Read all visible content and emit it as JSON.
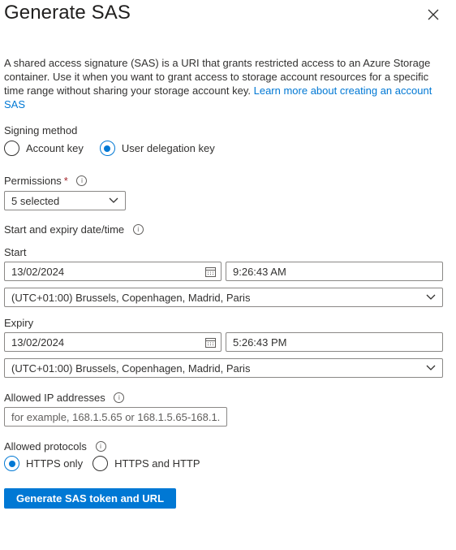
{
  "title": "Generate SAS",
  "description": {
    "text": "A shared access signature (SAS) is a URI that grants restricted access to an Azure Storage container. Use it when you want to grant access to storage account resources for a specific time range without sharing your storage account key.",
    "link": "Learn more about creating an account SAS"
  },
  "signing": {
    "label": "Signing method",
    "option1": "Account key",
    "option2": "User delegation key",
    "selected": "User delegation key"
  },
  "permissions": {
    "label": "Permissions",
    "required_mark": "*",
    "value": "5 selected"
  },
  "datetime": {
    "label": "Start and expiry date/time",
    "start_label": "Start",
    "start_date": "13/02/2024",
    "start_time": "9:26:43 AM",
    "start_tz": "(UTC+01:00) Brussels, Copenhagen, Madrid, Paris",
    "expiry_label": "Expiry",
    "expiry_date": "13/02/2024",
    "expiry_time": "5:26:43 PM",
    "expiry_tz": "(UTC+01:00) Brussels, Copenhagen, Madrid, Paris"
  },
  "ip": {
    "label": "Allowed IP addresses",
    "placeholder": "for example, 168.1.5.65 or 168.1.5.65-168.1...."
  },
  "protocols": {
    "label": "Allowed protocols",
    "option1": "HTTPS only",
    "option2": "HTTPS and HTTP",
    "selected": "HTTPS only"
  },
  "button": {
    "label": "Generate SAS token and URL"
  },
  "icons": {
    "info": "info-icon",
    "calendar": "calendar-icon",
    "chevron": "chevron-down-icon",
    "close": "close-icon"
  },
  "colors": {
    "accent": "#0078d4",
    "required": "#a4262c",
    "border": "#8a8886",
    "text": "#323130"
  }
}
